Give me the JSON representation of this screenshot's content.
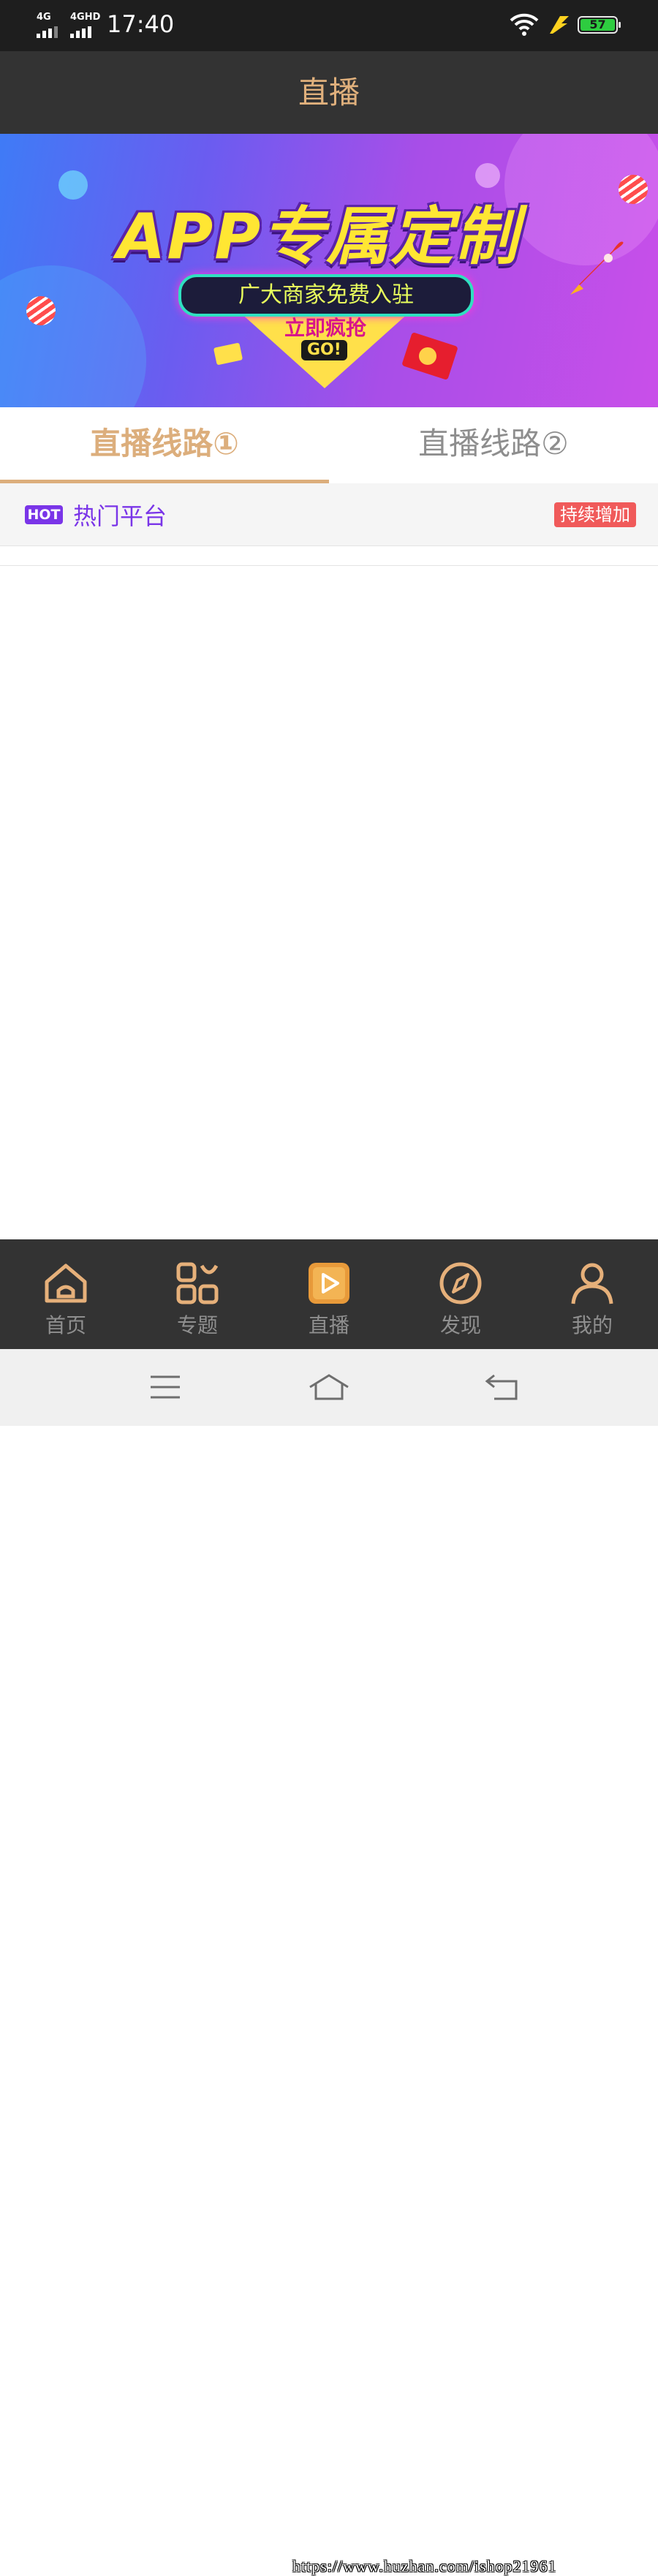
{
  "status_bar": {
    "network_1": "4G",
    "network_2": "4GHD",
    "time": "17:40",
    "battery": "57",
    "icons": [
      "signal-icon",
      "wifi-icon",
      "charging-bolt-icon",
      "battery-icon"
    ]
  },
  "header": {
    "title": "直播"
  },
  "banner": {
    "title": "APP专属定制",
    "subtitle": "广大商家免费入驻",
    "cta": "立即疯抢",
    "cta_go": "GO!"
  },
  "tabs": [
    {
      "label": "直播线路①",
      "active": true
    },
    {
      "label": "直播线路②",
      "active": false
    }
  ],
  "hot_section": {
    "badge": "HOT",
    "title": "热门平台",
    "tag": "持续增加"
  },
  "tab_bar": {
    "items": [
      {
        "label": "首页",
        "icon": "home-icon"
      },
      {
        "label": "专题",
        "icon": "topics-grid-icon"
      },
      {
        "label": "直播",
        "icon": "live-play-icon",
        "active": true
      },
      {
        "label": "发现",
        "icon": "compass-icon"
      },
      {
        "label": "我的",
        "icon": "user-icon"
      }
    ]
  },
  "watermark": "https://www.huzhan.com/ishop21961",
  "colors": {
    "accent": "#dcae7c",
    "header_bg": "#333333",
    "hot_purple": "#7a35e8",
    "tag_red": "#f05a5a"
  }
}
